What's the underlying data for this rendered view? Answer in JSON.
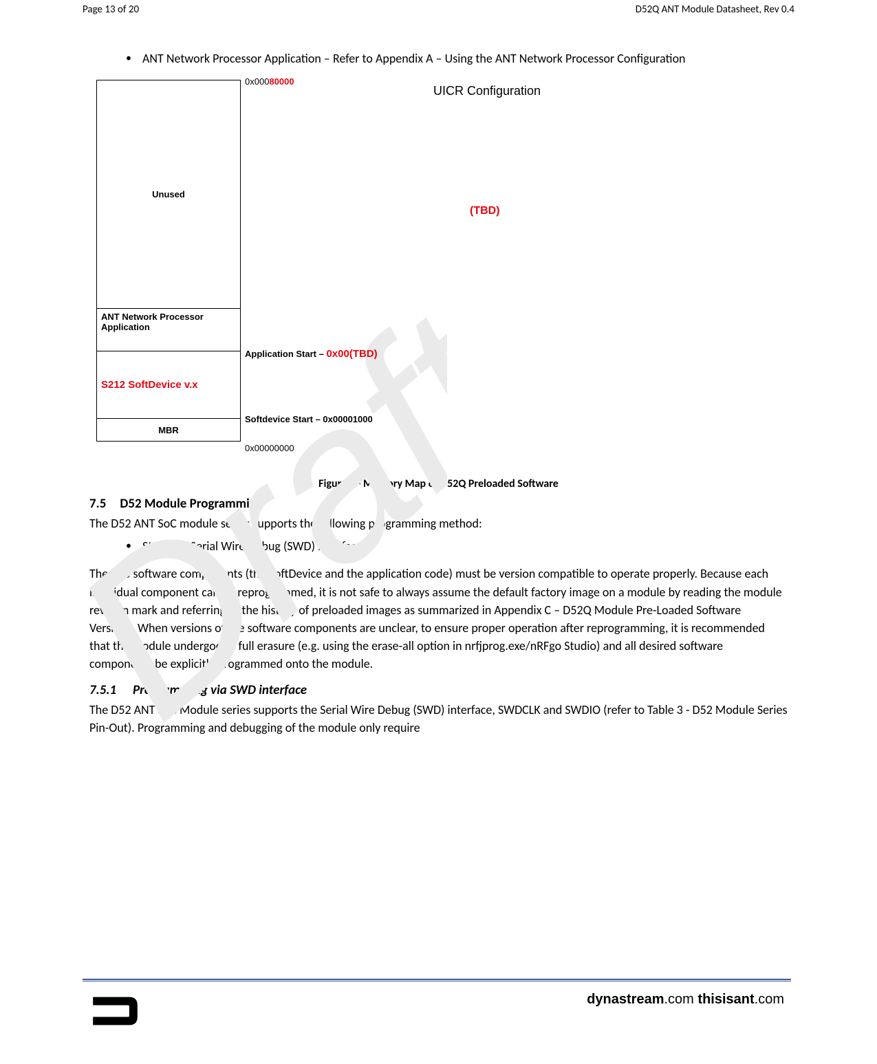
{
  "header": {
    "page_info": "Page 13 of 20",
    "doc_title": "D52Q ANT Module Datasheet, Rev 0.4"
  },
  "intro_bullet": "ANT Network Processor Application – Refer to Appendix A – Using the ANT Network Processor Configuration",
  "figure": {
    "mem_rows": {
      "unused": "Unused",
      "ant_app": "ANT Network Processor Application",
      "softdevice": "S212 SoftDevice v.x",
      "mbr": "MBR"
    },
    "addrs": {
      "top_prefix": "0x000",
      "top_red": "80000",
      "app_start_prefix": "Application Start – ",
      "app_start_red": "0x00(TBD)",
      "sd_start": "Softdevice Start – 0x00001000",
      "bottom": "0x00000000"
    },
    "uicr": "UICR Configuration",
    "tbd": "(TBD)",
    "caption": "Figure 7 - Memory Map of D52Q Preloaded Software"
  },
  "section75": {
    "num": "7.5",
    "title": "D52 Module Programming",
    "para1": "The D52 ANT SoC module series supports the following programming method:",
    "bullet1": "Standard Serial Wire Debug (SWD) interface",
    "para2": "The two software components (the SoftDevice and the application code) must be version compatible to operate properly. Because each individual component can be reprogrammed, it is not safe to always assume the default factory image on a module by reading the module revision mark and referring to the history of preloaded images as summarized in Appendix C – D52Q Module Pre-Loaded Software Versions. When versions of the software components are unclear, to ensure proper operation after reprogramming, it is recommended that the module undergoes a full erasure (e.g. using the erase-all option in nrfjprog.exe/nRFgo Studio) and all desired software components be explicitly programmed onto the module."
  },
  "section751": {
    "num": "7.5.1",
    "title": "Programming via SWD interface",
    "para1": "The D52 ANT SoC Module series supports the Serial Wire Debug (SWD) interface, SWDCLK and SWDIO (refer to Table 3 - D52 Module Series Pin-Out). Programming and debugging of the module only require"
  },
  "footer": {
    "link1": "dynastream",
    "link1_suffix": ".com ",
    "link2": "thisisant",
    "link2_suffix": ".com"
  }
}
